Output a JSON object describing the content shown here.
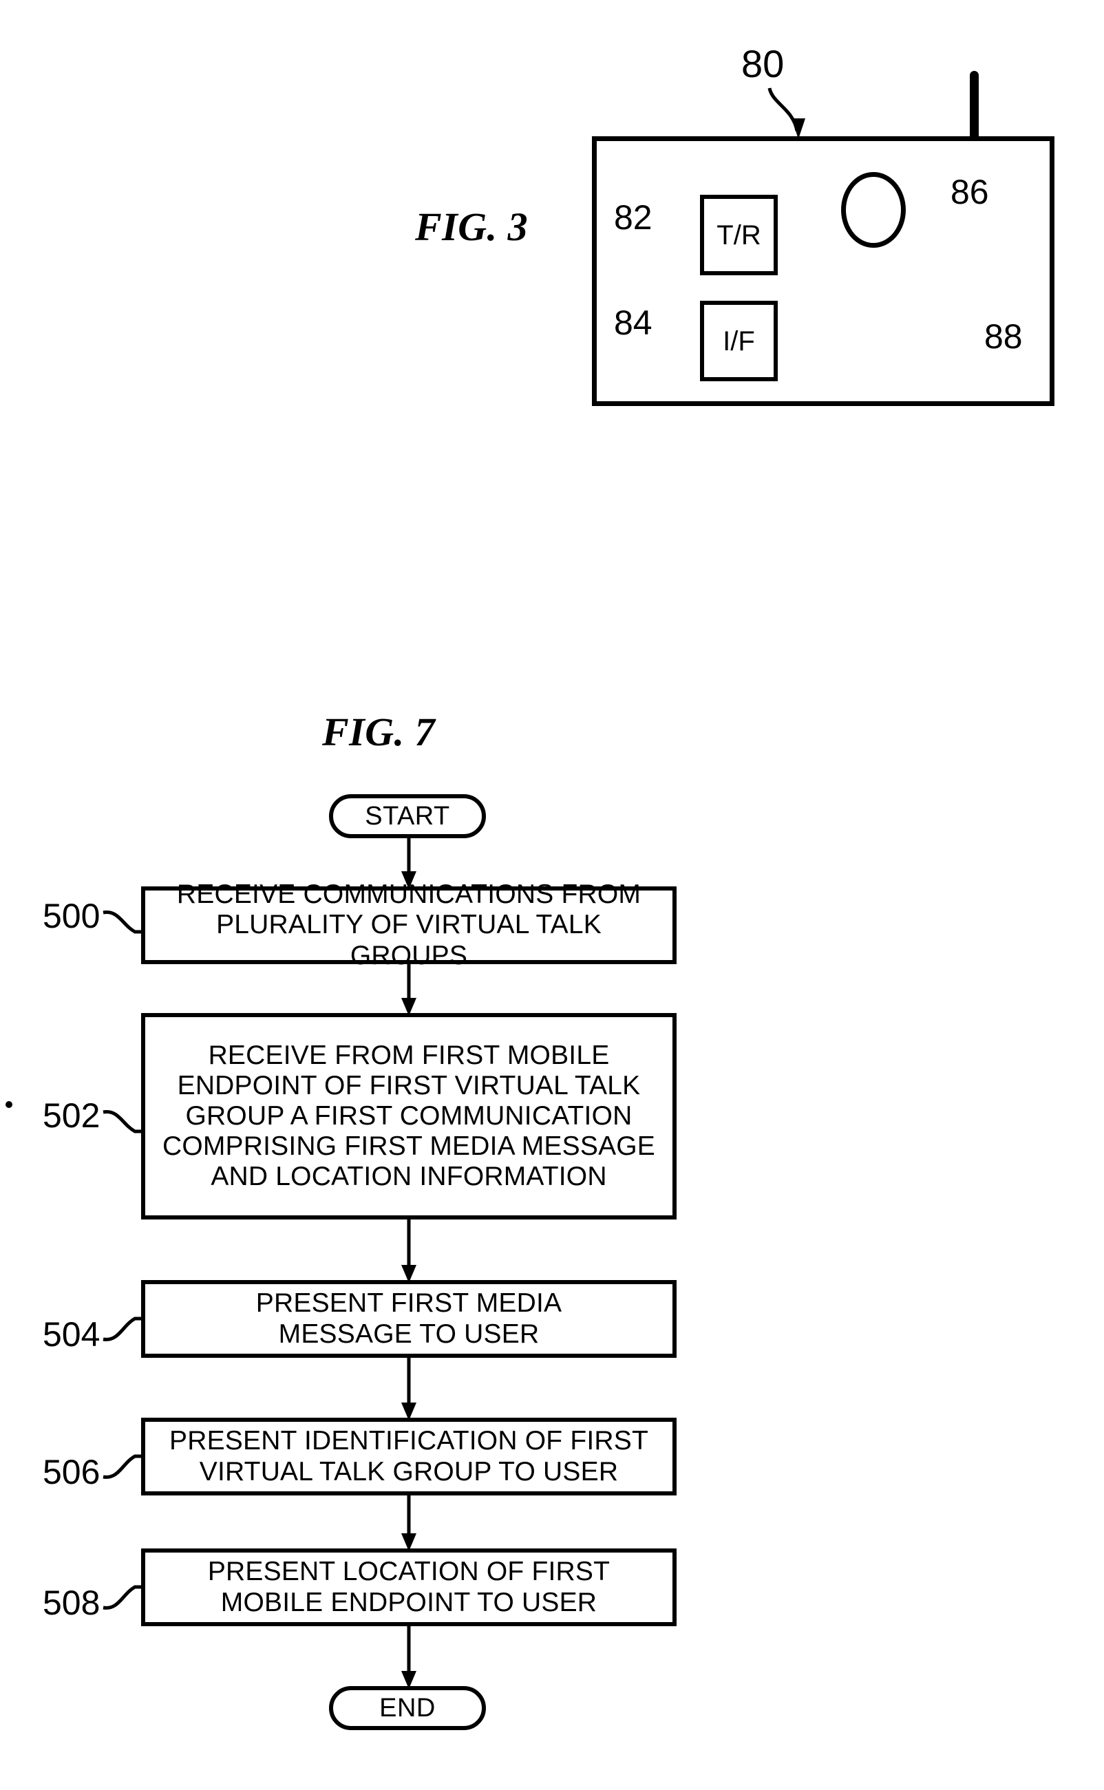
{
  "figures": [
    {
      "id": "fig3",
      "label": "FIG. 3",
      "refs": {
        "device": "80",
        "transceiver": "82",
        "interface": "84",
        "processor": "86",
        "memory": "88"
      },
      "blocks": {
        "transceiver_label": "T/R",
        "interface_label": "I/F"
      }
    },
    {
      "id": "fig7",
      "label": "FIG. 7",
      "start_label": "START",
      "end_label": "END",
      "steps": [
        {
          "ref": "500",
          "lines": [
            "RECEIVE COMMUNICATIONS FROM",
            "PLURALITY OF VIRTUAL TALK GROUPS"
          ],
          "text": "RECEIVE COMMUNICATIONS FROM PLURALITY OF VIRTUAL TALK GROUPS"
        },
        {
          "ref": "502",
          "lines": [
            "RECEIVE FROM FIRST MOBILE",
            "ENDPOINT OF FIRST VIRTUAL TALK",
            "GROUP A FIRST COMMUNICATION",
            "COMPRISING FIRST MEDIA MESSAGE",
            "AND LOCATION INFORMATION"
          ],
          "text": "RECEIVE FROM FIRST MOBILE ENDPOINT OF FIRST VIRTUAL TALK GROUP A FIRST COMMUNICATION COMPRISING FIRST MEDIA MESSAGE AND LOCATION INFORMATION"
        },
        {
          "ref": "504",
          "lines": [
            "PRESENT FIRST MEDIA",
            "MESSAGE TO USER"
          ],
          "text": "PRESENT FIRST MEDIA MESSAGE TO USER"
        },
        {
          "ref": "506",
          "lines": [
            "PRESENT IDENTIFICATION OF FIRST",
            "VIRTUAL TALK GROUP TO USER"
          ],
          "text": "PRESENT IDENTIFICATION OF FIRST VIRTUAL TALK GROUP TO USER"
        },
        {
          "ref": "508",
          "lines": [
            "PRESENT LOCATION OF FIRST",
            "MOBILE ENDPOINT TO USER"
          ],
          "text": "PRESENT LOCATION OF FIRST MOBILE ENDPOINT TO USER"
        }
      ]
    }
  ],
  "colors": {
    "ink": "#000000",
    "paper": "#ffffff"
  }
}
